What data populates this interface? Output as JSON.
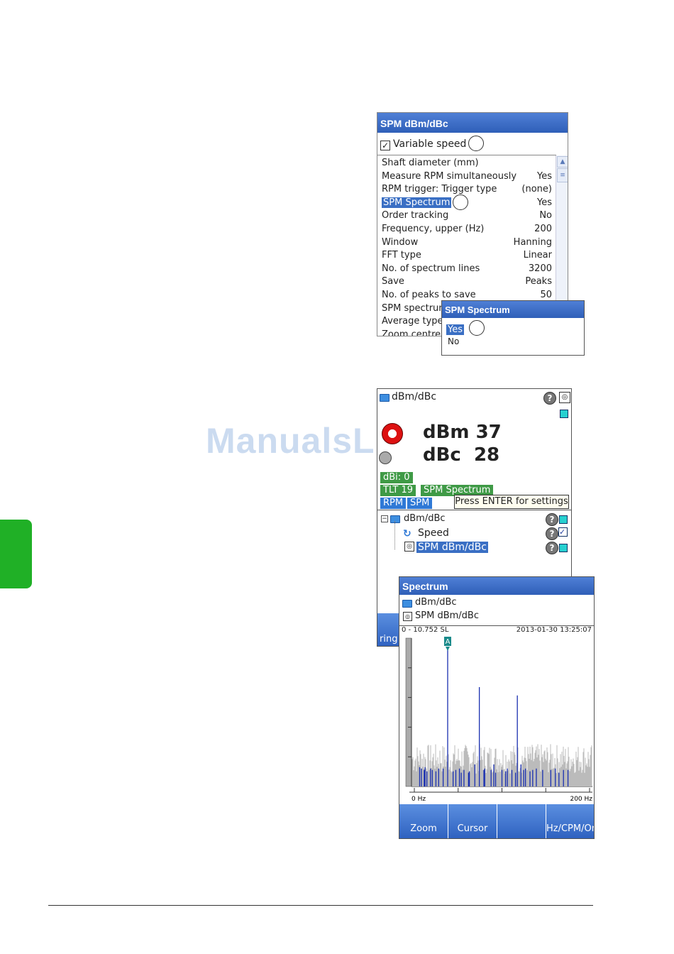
{
  "watermark": "ManualsLib.de",
  "settings_dialog": {
    "title": "SPM dBm/dBc",
    "variable_speed_label": "Variable speed",
    "variable_speed_checked": true,
    "rows": [
      {
        "label": "Shaft diameter (mm)",
        "value": ""
      },
      {
        "label": "Measure RPM simultaneously",
        "value": "Yes"
      },
      {
        "label": "RPM trigger: Trigger type",
        "value": "(none)"
      },
      {
        "label": "SPM Spectrum",
        "value": "Yes"
      },
      {
        "label": "Order tracking",
        "value": "No"
      },
      {
        "label": "Frequency, upper (Hz)",
        "value": "200"
      },
      {
        "label": "Window",
        "value": "Hanning"
      },
      {
        "label": "FFT type",
        "value": "Linear"
      },
      {
        "label": "No. of spectrum lines",
        "value": "3200"
      },
      {
        "label": "Save",
        "value": "Peaks"
      },
      {
        "label": "No. of peaks to save",
        "value": "50"
      },
      {
        "label": "SPM spectrum",
        "value": ""
      },
      {
        "label": "Average type",
        "value": ""
      },
      {
        "label": "Zoom centre",
        "value": ""
      }
    ]
  },
  "popup": {
    "title": "SPM Spectrum",
    "options": [
      "Yes",
      "No"
    ],
    "selected": "Yes"
  },
  "measurement": {
    "header": "dBm/dBc",
    "dbm_label": "dBm",
    "dbm_value": "37",
    "dbc_label": "dBc",
    "dbc_value": "28",
    "dbi": "dBi: 0",
    "tlt": "TLT 19",
    "spm_spectrum": "SPM Spectrum",
    "rpm": "RPM",
    "spm": "SPM",
    "tooltip": "Press ENTER for settings",
    "tree": {
      "root": "dBm/dBc",
      "speed": "Speed",
      "spm": "SPM dBm/dBc"
    },
    "softkey": "ring"
  },
  "spectrum": {
    "title": "Spectrum",
    "path1": "dBm/dBc",
    "path2": "SPM dBm/dBc",
    "range": "0 - 10.752 SL",
    "timestamp": "2013-01-30 13:25:07",
    "marker": "A",
    "x_start": "0 Hz",
    "x_end": "200 Hz",
    "keys": [
      "Zoom",
      "Cursor",
      "",
      "Hz/CPM/Or"
    ]
  },
  "chart_data": {
    "type": "bar",
    "xlabel": "",
    "ylabel": "",
    "xlim": [
      0,
      200
    ],
    "ylim": [
      0,
      10.752
    ],
    "peaks_hz": [
      9,
      11,
      14,
      15,
      17,
      21,
      23,
      27,
      30,
      35,
      40,
      46,
      49,
      53,
      55,
      58,
      63,
      64,
      70,
      75,
      80,
      81,
      88,
      91,
      93,
      100,
      104,
      106,
      111,
      115,
      117,
      121,
      124,
      126,
      131,
      134,
      138,
      145,
      154,
      159,
      163,
      168,
      173
    ],
    "peaks_sl": [
      1.4,
      1.3,
      1.2,
      1.4,
      1.1,
      1.3,
      1.2,
      1.1,
      1.3,
      1.3,
      10.0,
      1.1,
      1.2,
      1.3,
      1.0,
      1.2,
      1.0,
      1.1,
      1.6,
      7.2,
      1.2,
      1.3,
      1.2,
      1.6,
      1.0,
      1.2,
      1.1,
      1.3,
      1.2,
      1.0,
      6.6,
      1.6,
      1.2,
      1.3,
      1.1,
      1.2,
      1.3,
      1.2,
      1.2,
      1.3,
      1.0,
      1.2,
      1.2
    ],
    "marker_hz": 40
  }
}
